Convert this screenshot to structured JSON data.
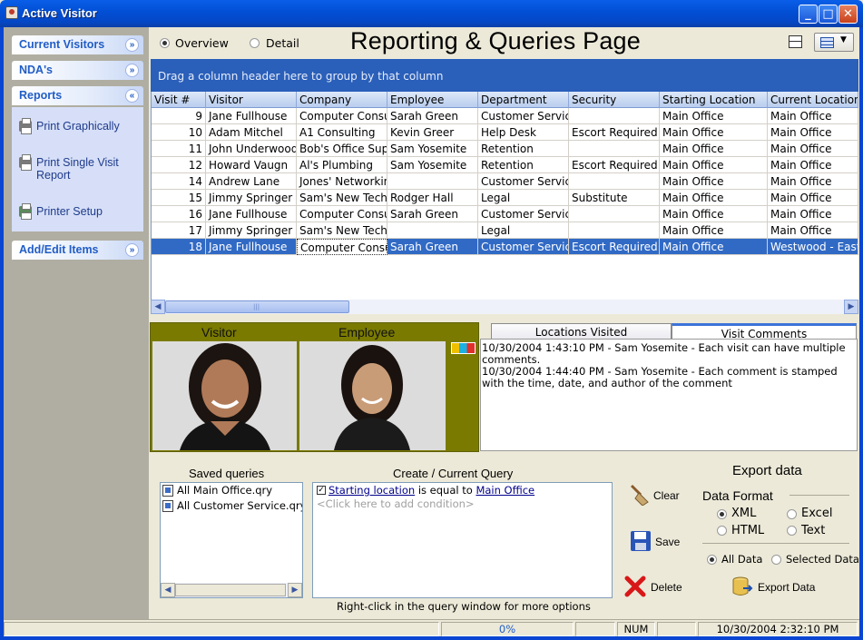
{
  "window": {
    "title": "Active Visitor"
  },
  "sidebar": {
    "sections": [
      {
        "label": "Current Visitors"
      },
      {
        "label": "NDA's"
      },
      {
        "label": "Reports"
      },
      {
        "label": "Add/Edit Items"
      }
    ],
    "report_items": [
      {
        "label": "Print Graphically"
      },
      {
        "label": "Print Single Visit Report"
      },
      {
        "label": "Printer Setup"
      }
    ]
  },
  "view_options": {
    "overview": "Overview",
    "detail": "Detail",
    "selected": "overview"
  },
  "page_title": "Reporting & Queries Page",
  "grid": {
    "group_hint": "Drag a column header here to group by that column",
    "columns": [
      "Visit #",
      "Visitor",
      "Company",
      "Employee",
      "Department",
      "Security",
      "Starting Location",
      "Current Location"
    ],
    "rows": [
      [
        "9",
        "Jane Fullhouse",
        "Computer Consu",
        "Sarah Green",
        "Customer Servic",
        "",
        "Main Office",
        "Main Office"
      ],
      [
        "10",
        "Adam Mitchel",
        "A1 Consulting",
        "Kevin Greer",
        "Help Desk",
        "Escort Required",
        "Main Office",
        "Main Office"
      ],
      [
        "11",
        "John Underwood",
        "Bob's Office Sup",
        "Sam Yosemite",
        "Retention",
        "",
        "Main Office",
        "Main Office"
      ],
      [
        "12",
        "Howard Vaugn",
        "Al's Plumbing",
        "Sam Yosemite",
        "Retention",
        "Escort Required",
        "Main Office",
        "Main Office"
      ],
      [
        "14",
        "Andrew Lane",
        "Jones' Networkin",
        "",
        "Customer Servic",
        "",
        "Main Office",
        "Main Office"
      ],
      [
        "15",
        "Jimmy Springer",
        "Sam's New Tech",
        "Rodger Hall",
        "Legal",
        "Substitute",
        "Main Office",
        "Main Office"
      ],
      [
        "16",
        "Jane Fullhouse",
        "Computer Consu",
        "Sarah Green",
        "Customer Servic",
        "",
        "Main Office",
        "Main Office"
      ],
      [
        "17",
        "Jimmy Springer",
        "Sam's New Tech",
        "",
        "Legal",
        "",
        "Main Office",
        "Main Office"
      ],
      [
        "18",
        "Jane Fullhouse",
        "Computer Consu",
        "Sarah Green",
        "Customer Servic",
        "Escort Required",
        "Main Office",
        "Westwood - East"
      ]
    ],
    "selected_row": 8
  },
  "photos": {
    "visitor_label": "Visitor",
    "employee_label": "Employee"
  },
  "tabs": {
    "locations": "Locations Visited",
    "comments": "Visit Comments",
    "active": "comments"
  },
  "comments": [
    "10/30/2004 1:43:10 PM - Sam Yosemite - Each visit can have multiple comments.",
    "10/30/2004 1:44:40 PM - Sam Yosemite - Each comment is stamped with the time, date, and author of the comment"
  ],
  "saved_queries": {
    "title": "Saved queries",
    "items": [
      "All Main Office.qry",
      "All Customer Service.qry"
    ]
  },
  "current_query": {
    "title": "Create / Current Query",
    "field": "Starting location",
    "operator": "is equal to",
    "value": "Main Office",
    "add_placeholder": "<Click here to add condition>",
    "hint": "Right-click in the query window for more options"
  },
  "buttons": {
    "clear": "Clear",
    "save": "Save",
    "delete": "Delete",
    "export": "Export Data"
  },
  "export": {
    "title": "Export data",
    "format_label": "Data Format",
    "formats": [
      "XML",
      "Excel",
      "HTML",
      "Text"
    ],
    "selected_format": "XML",
    "scope": [
      "All Data",
      "Selected Data"
    ],
    "selected_scope": "All Data"
  },
  "status": {
    "progress": "0%",
    "num": "NUM",
    "datetime": "10/30/2004 2:32:10 PM"
  },
  "colors": {
    "accent": "#215dc6",
    "selection": "#316ac5",
    "group_bar": "#2a5fba",
    "photo_frame": "#7a7a00"
  }
}
